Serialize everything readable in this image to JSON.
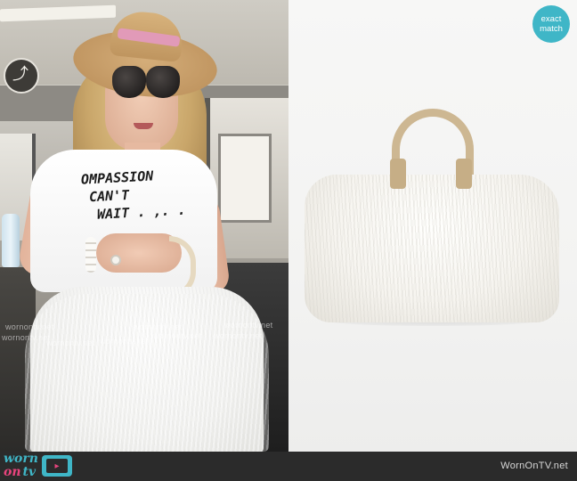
{
  "badge": {
    "line1": "exact",
    "line2": "match",
    "color": "#3fb6c7"
  },
  "tshirt_print": {
    "line1": "OMPASSION",
    "line2": "CAN'T",
    "line3": "WAIT . ,. ."
  },
  "watermarks": [
    "wornontv.net",
    "wornontv.net",
    "wornontv.net",
    "wornontv.net",
    "wornontv.net",
    "wornontv.net",
    "wornontv.net",
    "wornontv.net"
  ],
  "footer": {
    "logo_worn": "worn",
    "logo_on": "on",
    "logo_tv": "tv",
    "site_label": "WornOnTV.net",
    "bg_color": "#2b2b2b",
    "brand_teal": "#3fb6c7",
    "brand_pink": "#e8447d"
  },
  "icons": {
    "escalator_sign": "escalator-icon",
    "tv": "tv-icon"
  }
}
